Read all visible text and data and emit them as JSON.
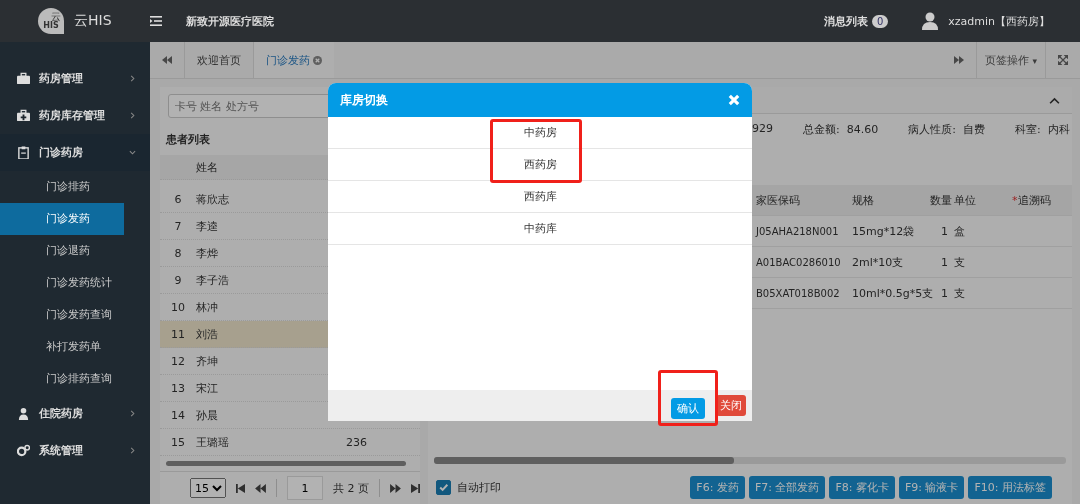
{
  "header": {
    "logo_top": "云",
    "logo_bottom": "HIS",
    "app_name": "云HIS",
    "hospital": "新致开源医疗医院",
    "messages_label": "消息列表",
    "messages_count": "0",
    "user": "xzadmin【西药房】"
  },
  "sidebar": {
    "items": [
      {
        "label": "药房管理",
        "expanded": false
      },
      {
        "label": "药房库存管理",
        "expanded": false
      },
      {
        "label": "门诊药房",
        "expanded": true,
        "children": [
          {
            "label": "门诊排药",
            "selected": false
          },
          {
            "label": "门诊发药",
            "selected": true
          },
          {
            "label": "门诊退药",
            "selected": false
          },
          {
            "label": "门诊发药统计",
            "selected": false
          },
          {
            "label": "门诊发药查询",
            "selected": false
          },
          {
            "label": "补打发药单",
            "selected": false
          },
          {
            "label": "门诊排药查询",
            "selected": false
          }
        ]
      },
      {
        "label": "住院药房",
        "expanded": false
      },
      {
        "label": "系统管理",
        "expanded": false
      }
    ]
  },
  "tabs": [
    {
      "label": "欢迎首页",
      "selected": false,
      "closable": false
    },
    {
      "label": "门诊发药",
      "selected": true,
      "closable": true
    }
  ],
  "tab_actions": {
    "label": "页签操作",
    "caret": "▾"
  },
  "patient_panel": {
    "search": {
      "placeholder": "卡号 姓名 处方号"
    },
    "title": "患者列表",
    "columns": [
      "姓名"
    ],
    "rows": [
      {
        "no": "6",
        "name": "蒋欣志",
        "selected": false
      },
      {
        "no": "7",
        "name": "李逵",
        "selected": false
      },
      {
        "no": "8",
        "name": "李烨",
        "selected": false
      },
      {
        "no": "9",
        "name": "李子浩",
        "selected": false
      },
      {
        "no": "10",
        "name": "林冲",
        "selected": false
      },
      {
        "no": "11",
        "name": "刘浩",
        "selected": true
      },
      {
        "no": "12",
        "name": "齐坤",
        "selected": false
      },
      {
        "no": "13",
        "name": "宋江",
        "selected": false
      },
      {
        "no": "14",
        "name": "孙晨",
        "selected": false
      },
      {
        "no": "15",
        "name": "王璐瑶",
        "column_3": "236",
        "selected": false
      }
    ],
    "pager": {
      "page_size": "15",
      "page": "1",
      "total": "共 2 页"
    }
  },
  "detail_panel": {
    "info": [
      {
        "value": "929"
      },
      {
        "label": "总金额:",
        "value": "84.60"
      },
      {
        "label": "病人性质:",
        "value": "自费"
      },
      {
        "label": "科室:",
        "value": "内科"
      }
    ],
    "columns": [
      {
        "label": "家医保码"
      },
      {
        "label": "规格"
      },
      {
        "label": "数量"
      },
      {
        "label": "单位"
      },
      {
        "label": "追溯码",
        "required_mark": "*"
      }
    ],
    "rows": [
      {
        "code": "J05AHA218N001",
        "spec": "15mg*12袋",
        "qty": "1",
        "unit": "盒"
      },
      {
        "code": "A01BAC0286010",
        "spec": "2ml*10支",
        "qty": "1",
        "unit": "支"
      },
      {
        "code": "B05XAT018B002",
        "spec": "10ml*0.5g*5支",
        "qty": "1",
        "unit": "支"
      }
    ]
  },
  "auto_print": {
    "label": "自动打印",
    "checked": true
  },
  "function_buttons": [
    "F6: 发药",
    "F7: 全部发药",
    "F8: 雾化卡",
    "F9: 输液卡",
    "F10: 用法标签"
  ],
  "dialog": {
    "title": "库房切换",
    "options": [
      {
        "label": "中药房",
        "highlighted": true
      },
      {
        "label": "西药房",
        "highlighted": true
      },
      {
        "label": "西药库",
        "highlighted": false
      },
      {
        "label": "中药库",
        "highlighted": false
      }
    ],
    "confirm": {
      "label": "确认",
      "highlighted": true
    },
    "close": {
      "label": "关闭"
    }
  }
}
